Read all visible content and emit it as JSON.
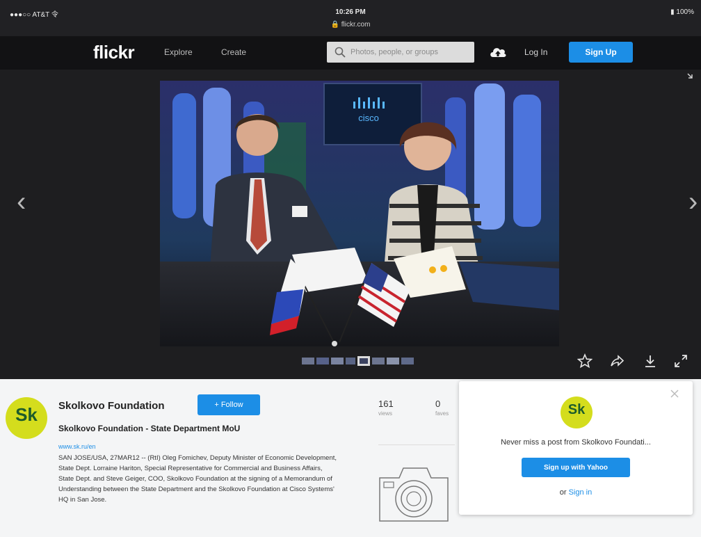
{
  "status_bar": {
    "carrier": "●●●○○ AT&T 令",
    "time": "10:26 PM",
    "url": "🔒 flickr.com",
    "battery": "▮ 100%"
  },
  "header": {
    "logo": "flickr",
    "nav": {
      "explore": "Explore",
      "create": "Create"
    },
    "search_placeholder": "Photos, people, or groups",
    "login": "Log In",
    "signup": "Sign Up"
  },
  "photo_stage": {
    "prev_glyph": "‹",
    "next_glyph": "›",
    "photo_icons": [
      "star-icon",
      "share-icon",
      "download-icon",
      "fullscreen-icon"
    ]
  },
  "owner": {
    "avatar_text": "Sk",
    "name": "Skolkovo Foundation",
    "follow_label": "+ Follow",
    "photo_title": "Skolkovo Foundation - State Department MoU",
    "url": "www.sk.ru/en",
    "description": "SAN JOSE/USA, 27MAR12 -- (RtI) Oleg Fomichev, Deputy Minister of Economic Development, State Dept. Lorraine Hariton, Special Representative for Commercial and Business Affairs, State Dept. and Steve Geiger, COO, Skolkovo Foundation at the signing of a Memorandum of Understanding between the State Department and the Skolkovo Foundation at Cisco Systems' HQ in San Jose."
  },
  "stats": {
    "views_count": "161",
    "views_label": "views",
    "faves_count": "0",
    "faves_label": "faves"
  },
  "popup": {
    "logo_text": "Sk",
    "message": "Never miss a post from Skolkovo Foundati...",
    "yahoo_button": "Sign up with Yahoo",
    "or_text": "or",
    "signin_link": "Sign in"
  },
  "colors": {
    "accent_blue": "#1c8ee6",
    "header_bg": "#121214",
    "stage_bg": "#1e1e20",
    "skolkovo_yellow": "#d4dd1d"
  }
}
